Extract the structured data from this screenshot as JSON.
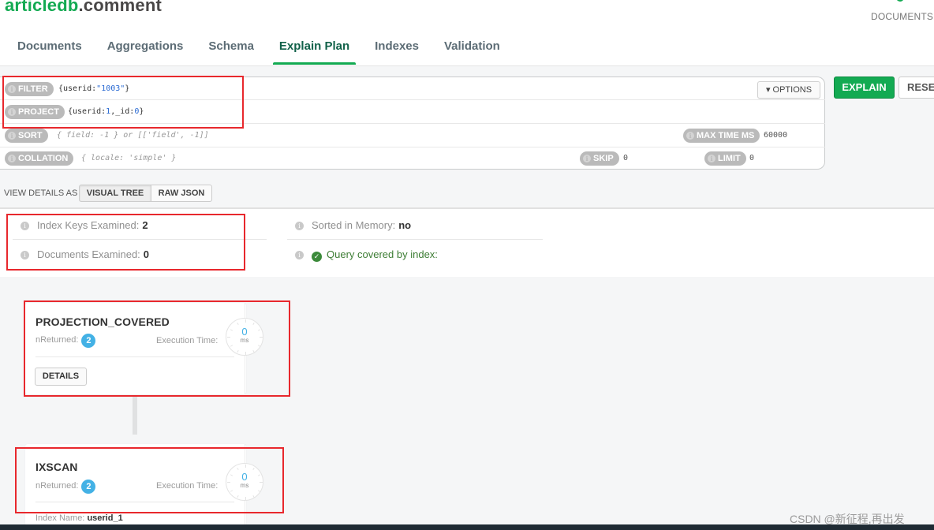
{
  "header": {
    "namespace_db": "articledb",
    "namespace_coll": ".comment",
    "documents_label": "DOCUMENTS"
  },
  "tabs": [
    {
      "label": "Documents",
      "active": false
    },
    {
      "label": "Aggregations",
      "active": false
    },
    {
      "label": "Schema",
      "active": false
    },
    {
      "label": "Explain Plan",
      "active": true
    },
    {
      "label": "Indexes",
      "active": false
    },
    {
      "label": "Validation",
      "active": false
    }
  ],
  "query": {
    "filter_label": "FILTER",
    "filter_value_prefix": "{userid:",
    "filter_value_str": "\"1003\"",
    "filter_value_suffix": "}",
    "project_label": "PROJECT",
    "project_value_a": "{userid:",
    "project_value_n1": "1",
    "project_value_b": ",_id:",
    "project_value_n2": "0",
    "project_value_c": "}",
    "sort_label": "SORT",
    "sort_placeholder": "{ field: -1 } or [['field', -1]]",
    "collation_label": "COLLATION",
    "collation_placeholder": "{ locale: 'simple' }",
    "max_time_label": "MAX TIME MS",
    "max_time_value": "60000",
    "skip_label": "SKIP",
    "skip_value": "0",
    "limit_label": "LIMIT",
    "limit_value": "0",
    "options_label": "OPTIONS",
    "explain_label": "EXPLAIN",
    "reset_label": "RESET"
  },
  "view": {
    "label": "VIEW DETAILS AS",
    "visual_tree": "VISUAL TREE",
    "raw_json": "RAW JSON",
    "selected": "VISUAL TREE"
  },
  "stats": {
    "index_keys_label": "Index Keys Examined:",
    "index_keys_value": "2",
    "docs_examined_label": "Documents Examined:",
    "docs_examined_value": "0",
    "sorted_label": "Sorted in Memory:",
    "sorted_value": "no",
    "covered_label": "Query covered by index:"
  },
  "stages": [
    {
      "name": "PROJECTION_COVERED",
      "nreturned_label": "nReturned:",
      "nreturned": "2",
      "exec_label": "Execution Time:",
      "exec_value": "0",
      "exec_unit": "ms",
      "details_label": "DETAILS"
    },
    {
      "name": "IXSCAN",
      "nreturned_label": "nReturned:",
      "nreturned": "2",
      "exec_label": "Execution Time:",
      "exec_value": "0",
      "exec_unit": "ms",
      "index_name_label": "Index Name:",
      "index_name": "userid_1"
    }
  ],
  "watermark": "CSDN @新征程,再出发"
}
